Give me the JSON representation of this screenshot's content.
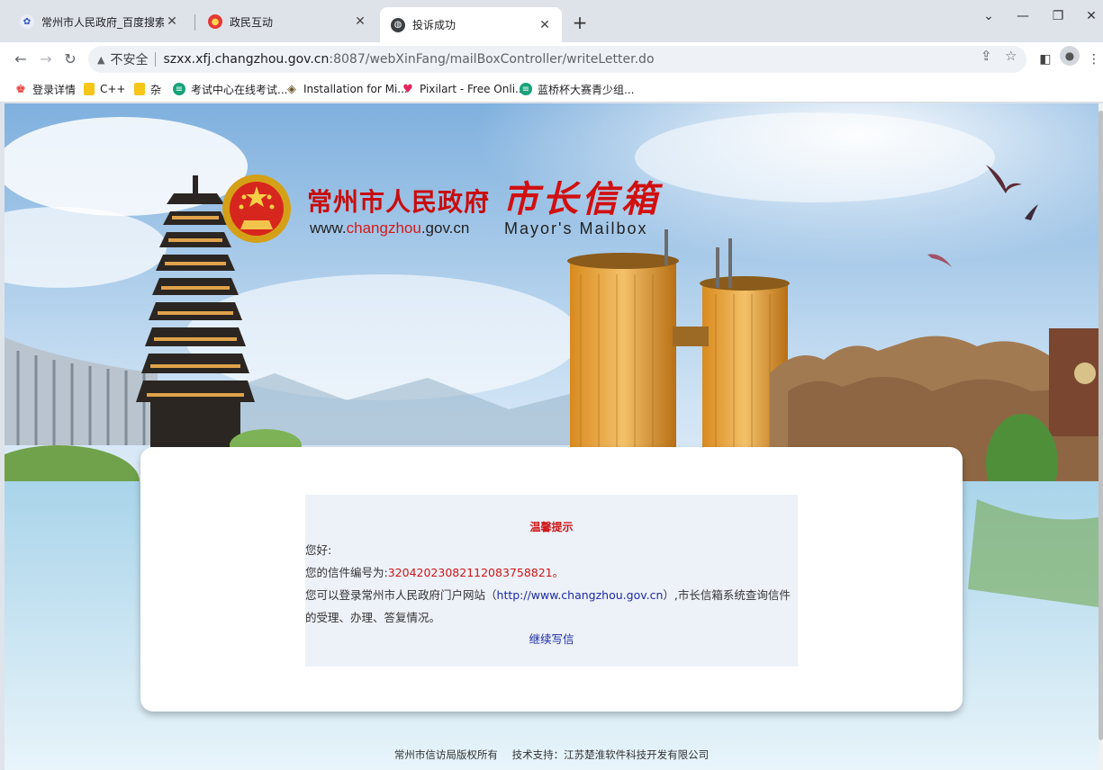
{
  "browser": {
    "tabs": [
      {
        "label": "常州市人民政府_百度搜索",
        "active": false
      },
      {
        "label": "政民互动",
        "active": false
      },
      {
        "label": "投诉成功",
        "active": true
      }
    ],
    "address": {
      "security_label": "不安全",
      "url_host": "szxx.xfj.changzhou.gov.cn",
      "url_path": ":8087/webXinFang/mailBoxController/writeLetter.do"
    },
    "bookmarks": [
      {
        "label": "登录详情",
        "icon": "red-person-icon"
      },
      {
        "label": "C++",
        "icon": "folder-icon"
      },
      {
        "label": "杂",
        "icon": "folder-icon"
      },
      {
        "label": "考试中心在线考试...",
        "icon": "green-exam-icon"
      },
      {
        "label": "Installation for Mi...",
        "icon": "diamond-icon"
      },
      {
        "label": "Pixilart - Free Onli...",
        "icon": "heart-icon"
      },
      {
        "label": "蓝桥杯大赛青少组...",
        "icon": "green-exam-icon"
      }
    ]
  },
  "header": {
    "title": "常州市人民政府",
    "dot": "·",
    "calligraphy": "市长信箱",
    "url_prefix": "www.",
    "url_mid": "changzhou",
    "url_suffix": ".gov.cn",
    "english": "Mayor's Mailbox"
  },
  "notice": {
    "title": "温馨提示",
    "greeting": "您好:",
    "number_label": "您的信件编号为:",
    "number_value": "320420230821120837588​21",
    "number_period": "。",
    "info_prefix": "您可以登录常州市人民政府门户网站（",
    "info_link": "http://www.changzhou.gov.cn",
    "info_suffix": "）,市长信箱系统查询信件",
    "info_line2": "的受理、办理、答复情况。",
    "continue_label": "继续写信"
  },
  "footer": {
    "copyright": "常州市信访局版权所有",
    "support": "技术支持：江苏楚淮软件科技开发有限公司"
  },
  "colors": {
    "accent_red": "#cf1616",
    "link_blue": "#1a2aa8"
  }
}
